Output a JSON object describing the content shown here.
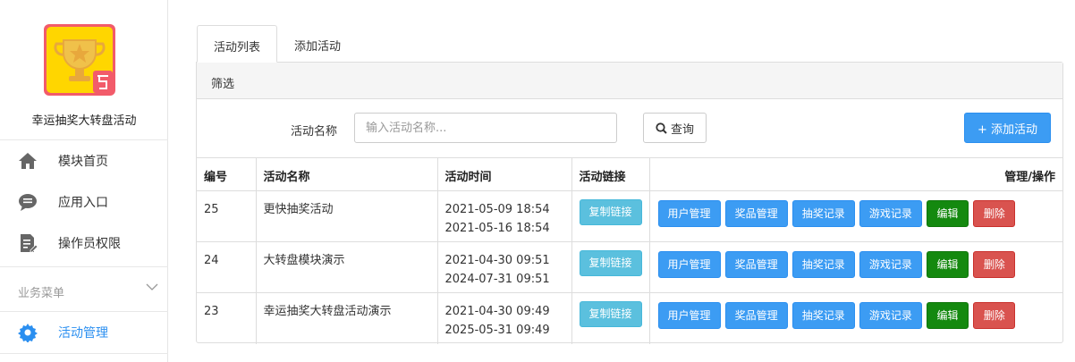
{
  "sidebar": {
    "app_title": "幸运抽奖大转盘活动",
    "items": [
      {
        "label": "模块首页",
        "icon": "home-icon"
      },
      {
        "label": "应用入口",
        "icon": "chat-bubble-icon"
      },
      {
        "label": "操作员权限",
        "icon": "document-edit-icon"
      }
    ],
    "section": {
      "label": "业务菜单",
      "icon": "chevron-down-icon"
    },
    "active_item": {
      "label": "活动管理",
      "icon": "gear-icon"
    }
  },
  "tabs": [
    {
      "label": "活动列表",
      "active": true
    },
    {
      "label": "添加活动",
      "active": false
    }
  ],
  "filter": {
    "panel_title": "筛选",
    "name_label": "活动名称",
    "name_placeholder": "输入活动名称...",
    "search_label": "查询",
    "add_label": "+ 添加活动"
  },
  "table": {
    "headers": {
      "id": "编号",
      "name": "活动名称",
      "time": "活动时间",
      "link": "活动链接",
      "manage": "管理/操作"
    },
    "copy_label": "复制链接",
    "action_labels": {
      "users": "用户管理",
      "prizes": "奖品管理",
      "draws": "抽奖记录",
      "games": "游戏记录",
      "edit": "编辑",
      "delete": "删除"
    },
    "rows": [
      {
        "id": "25",
        "name": "更快抽奖活动",
        "start": "2021-05-09 18:54",
        "end": "2021-05-16 18:54"
      },
      {
        "id": "24",
        "name": "大转盘模块演示",
        "start": "2021-04-30 09:51",
        "end": "2024-07-31 09:51"
      },
      {
        "id": "23",
        "name": "幸运抽奖大转盘活动演示",
        "start": "2021-04-30 09:49",
        "end": "2025-05-31 09:49"
      }
    ]
  },
  "colors": {
    "primary": "#3c9cf3",
    "info": "#5bc0de",
    "success": "#14890f",
    "danger": "#d9534f",
    "logo_bg": "#ffd600",
    "logo_border": "#f25b6a"
  }
}
